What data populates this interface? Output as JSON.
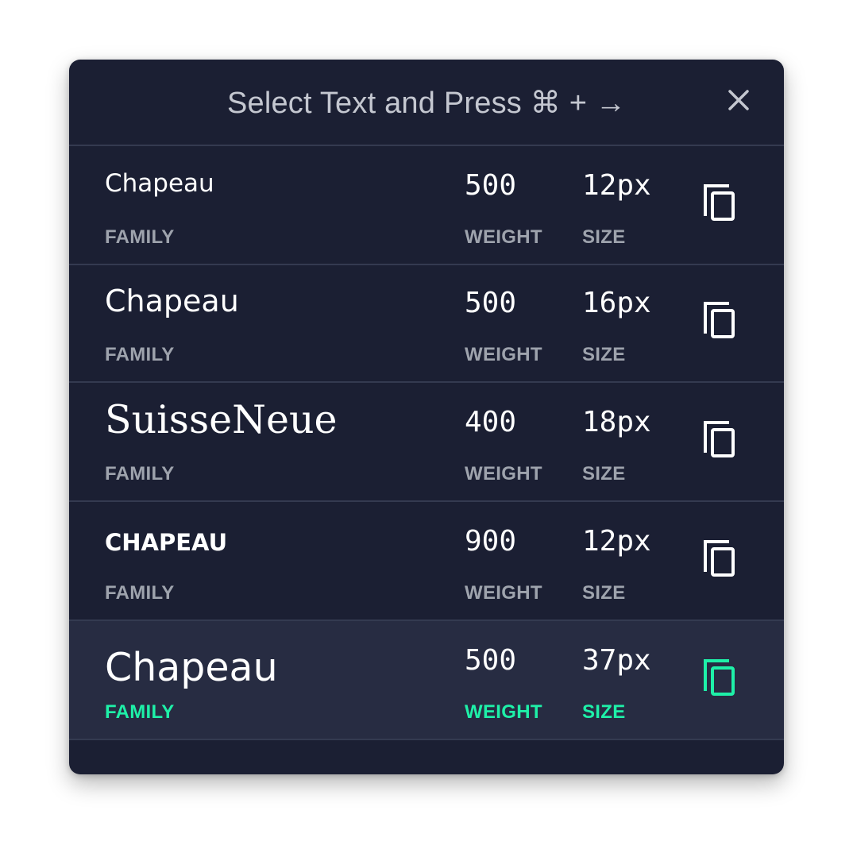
{
  "header": {
    "title": "Select Text and Press ⌘ + →",
    "close_icon": "close-icon"
  },
  "labels": {
    "family": "FAMILY",
    "weight": "WEIGHT",
    "size": "SIZE"
  },
  "colors": {
    "panel_bg": "#1b1f33",
    "row_active_bg": "#272c42",
    "divider": "#343a50",
    "label": "#9ea3ad",
    "accent": "#1ef0a8",
    "text": "#ffffff"
  },
  "rows": [
    {
      "family": "Chapeau",
      "weight": "500",
      "size": "12px",
      "active": false,
      "copy_icon": "copy-icon"
    },
    {
      "family": "Chapeau",
      "weight": "500",
      "size": "16px",
      "active": false,
      "copy_icon": "copy-icon"
    },
    {
      "family": "SuisseNeue",
      "weight": "400",
      "size": "18px",
      "active": false,
      "copy_icon": "copy-icon"
    },
    {
      "family": "CHAPEAU",
      "weight": "900",
      "size": "12px",
      "active": false,
      "copy_icon": "copy-icon"
    },
    {
      "family": "Chapeau",
      "weight": "500",
      "size": "37px",
      "active": true,
      "copy_icon": "copy-icon"
    }
  ]
}
